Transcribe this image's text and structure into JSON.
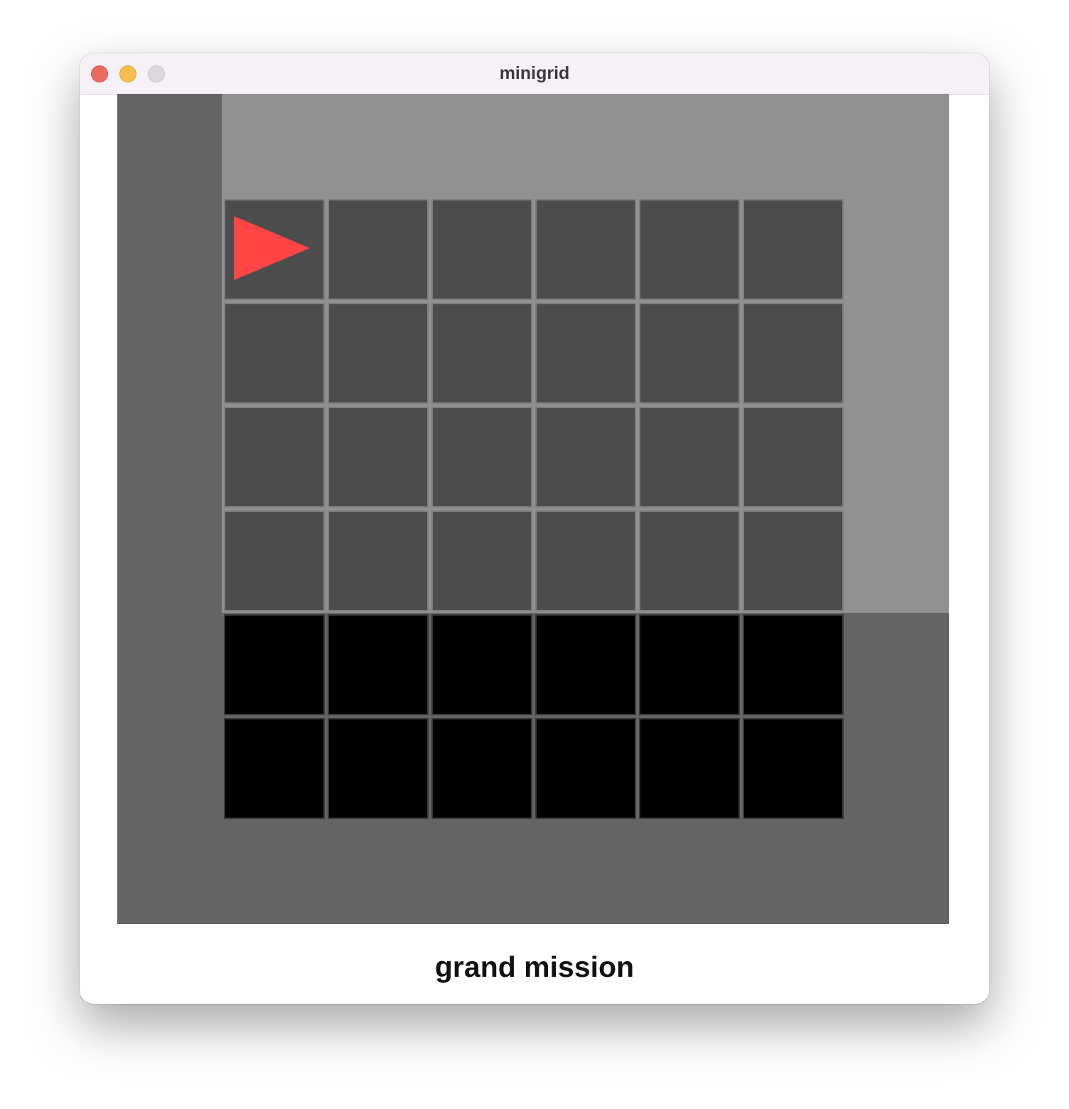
{
  "window": {
    "title": "minigrid"
  },
  "game": {
    "grid_cols": 6,
    "grid_rows": 6,
    "visible_rows": 4,
    "agent": {
      "col": 0,
      "row": 0,
      "direction": "right",
      "color": "#ff4545"
    },
    "colors": {
      "wall": "#646464",
      "visible_highlight": "#919191",
      "seen_cell": "#4c4c4c",
      "unseen_cell": "#000000",
      "grid_line": "#7f7f7f"
    }
  },
  "mission": "grand mission"
}
